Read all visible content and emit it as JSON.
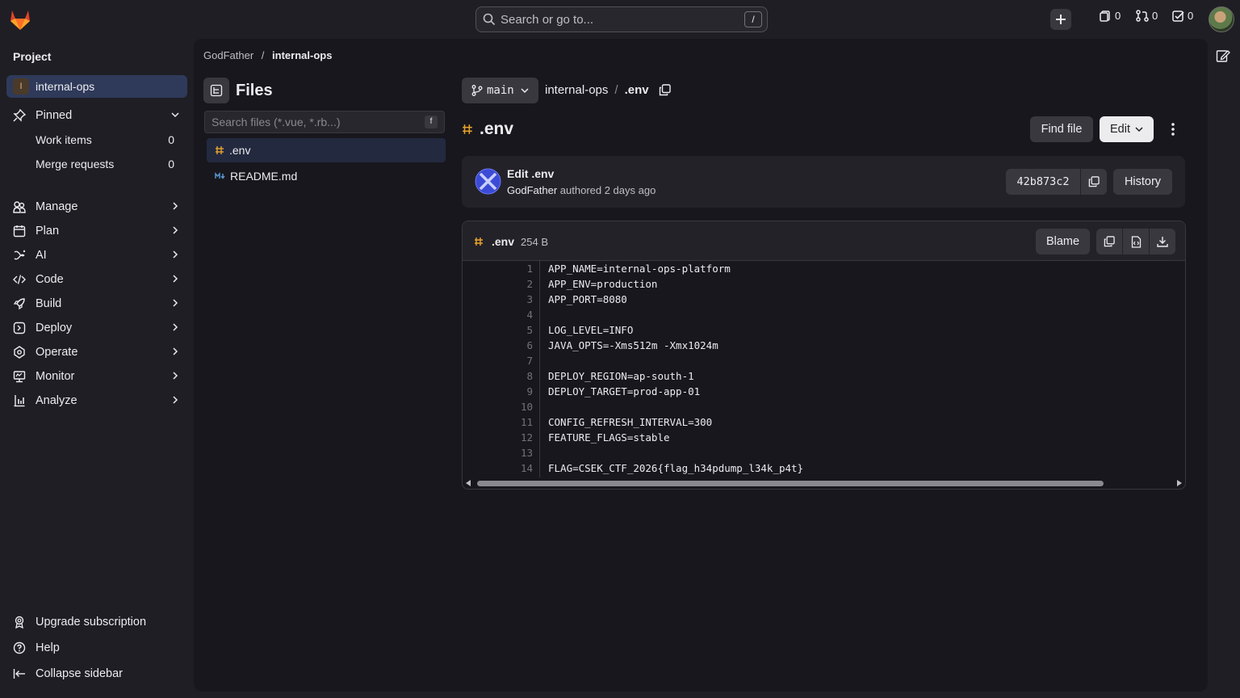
{
  "topbar": {
    "search_placeholder": "Search or go to...",
    "search_shortcut": "/",
    "issues_count": "0",
    "merge_requests_count": "0",
    "todos_count": "0"
  },
  "sidebar": {
    "heading": "Project",
    "project": {
      "initial": "I",
      "name": "internal-ops"
    },
    "pinned_label": "Pinned",
    "pinned_items": [
      {
        "label": "Work items",
        "count": "0"
      },
      {
        "label": "Merge requests",
        "count": "0"
      }
    ],
    "nav": [
      {
        "label": "Manage",
        "icon": "manage-icon"
      },
      {
        "label": "Plan",
        "icon": "plan-icon"
      },
      {
        "label": "AI",
        "icon": "ai-icon"
      },
      {
        "label": "Code",
        "icon": "code-icon"
      },
      {
        "label": "Build",
        "icon": "build-icon"
      },
      {
        "label": "Deploy",
        "icon": "deploy-icon"
      },
      {
        "label": "Operate",
        "icon": "operate-icon"
      },
      {
        "label": "Monitor",
        "icon": "monitor-icon"
      },
      {
        "label": "Analyze",
        "icon": "analyze-icon"
      }
    ],
    "footer": {
      "upgrade": "Upgrade subscription",
      "help": "Help",
      "collapse": "Collapse sidebar"
    }
  },
  "breadcrumb": {
    "owner": "GodFather",
    "separator": "/",
    "project": "internal-ops"
  },
  "files": {
    "title": "Files",
    "search_placeholder": "Search files (*.vue, *.rb...)",
    "search_shortcut": "f",
    "items": [
      {
        "name": ".env",
        "active": true
      },
      {
        "name": "README.md",
        "active": false
      }
    ]
  },
  "blob_header": {
    "branch": "main",
    "path_root": "internal-ops",
    "path_sep": "/",
    "path_file": ".env",
    "file_title": ".env",
    "find_file": "Find file",
    "edit": "Edit"
  },
  "commit": {
    "title": "Edit .env",
    "author": "GodFather",
    "meta": "authored 2 days ago",
    "sha": "42b873c2",
    "history": "History"
  },
  "blob": {
    "name": ".env",
    "size": "254 B",
    "blame": "Blame",
    "lines": [
      {
        "n": "1",
        "text": "APP_NAME=internal-ops-platform"
      },
      {
        "n": "2",
        "text": "APP_ENV=production"
      },
      {
        "n": "3",
        "text": "APP_PORT=8080"
      },
      {
        "n": "4",
        "text": ""
      },
      {
        "n": "5",
        "text": "LOG_LEVEL=INFO"
      },
      {
        "n": "6",
        "text": "JAVA_OPTS=-Xms512m -Xmx1024m"
      },
      {
        "n": "7",
        "text": ""
      },
      {
        "n": "8",
        "text": "DEPLOY_REGION=ap-south-1"
      },
      {
        "n": "9",
        "text": "DEPLOY_TARGET=prod-app-01"
      },
      {
        "n": "10",
        "text": ""
      },
      {
        "n": "11",
        "text": "CONFIG_REFRESH_INTERVAL=300"
      },
      {
        "n": "12",
        "text": "FEATURE_FLAGS=stable"
      },
      {
        "n": "13",
        "text": ""
      },
      {
        "n": "14",
        "text": "FLAG=CSEK_CTF_2026{flag_h34pdump_l34k_p4t}"
      }
    ]
  },
  "colors": {
    "accent_active": "#2f3a5a",
    "env_icon": "#e9a42c",
    "markdown_icon": "#5b9bd5"
  }
}
